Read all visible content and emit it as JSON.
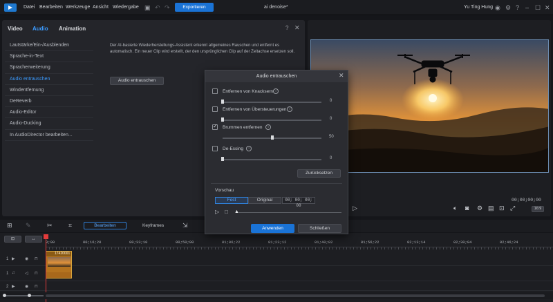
{
  "menubar": {
    "items": [
      "Datei",
      "Bearbeiten",
      "Werkzeuge",
      "Ansicht",
      "Wiedergabe"
    ],
    "export_label": "Exportieren",
    "title": "ai denoise*",
    "user": "Yu Ting Hung"
  },
  "left_panel": {
    "tabs": [
      "Video",
      "Audio",
      "Animation"
    ],
    "active_tab": "Audio",
    "help": "?",
    "close": "✕",
    "side_items": [
      "Lautstärke/Ein-/Ausblenden",
      "Sprache-in-Text",
      "Spracherweiterung",
      "Audio entrauschen",
      "Windentfernung",
      "DeReverb",
      "Audio-Editor",
      "Audio-Ducking",
      "In AudioDirector bearbeiten..."
    ],
    "active_item": "Audio entrauschen",
    "description": "Der AI-basierte Wiederherstellungs-Assistent erkennt allgemeines Rauschen und entfernt es automatisch. Ein neuer Clip wird erstellt, der den ursprünglichen Clip auf der Zeitachse ersetzen soll.",
    "action_button": "Audio entrauschen"
  },
  "preview": {
    "timecode": "00;00;00;00",
    "aspect": "16:9"
  },
  "dialog": {
    "title": "Audio entrauschen",
    "options": [
      {
        "label": "Entfernen von Knacksern",
        "checked": false,
        "value": "0",
        "level": 0
      },
      {
        "label": "Entfernen von Übersteuerungen",
        "checked": false,
        "value": "0",
        "level": 0
      },
      {
        "label": "Brummen entfernen",
        "checked": true,
        "value": "50",
        "level": 0.5
      },
      {
        "label": "De-Essing",
        "checked": false,
        "value": "0",
        "level": 0
      }
    ],
    "reset_label": "Zurücksetzen",
    "preview_label": "Vorschau",
    "fixed_label": "Fest",
    "original_label": "Original",
    "preview_timecode": "00; 00; 00; 00",
    "apply_label": "Anwenden",
    "close_label": "Schließen"
  },
  "toolbar": {
    "edit_label": "Bearbeiten",
    "keyframes_label": "Keyframes"
  },
  "timeline": {
    "ruler": [
      "0;00",
      "00;16;20",
      "00;33;10",
      "00;50;00",
      "01;06;22",
      "01;23;12",
      "01;40;02",
      "01;56;22",
      "02;13;14",
      "02;30;04",
      "02;46;24"
    ],
    "clip_label": "17420001",
    "tracks": [
      "1",
      "1",
      "2"
    ]
  },
  "colors": {
    "accent": "#1a73d6",
    "active_text": "#3b9bff",
    "clip": "#b4731f",
    "playhead": "#e23b3b"
  }
}
